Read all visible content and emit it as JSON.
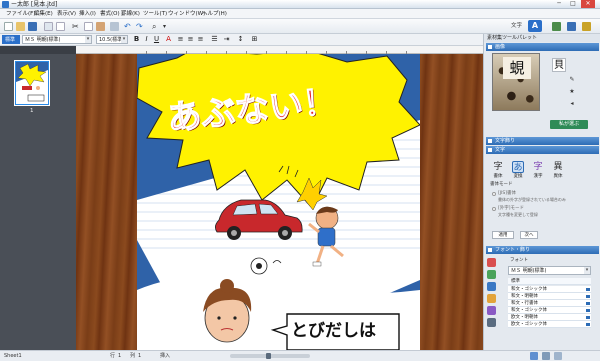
{
  "app": {
    "title": "ー太郎 [見本.jtd]"
  },
  "menus": [
    "ファイル(F)",
    "編集(E)",
    "表示(V)",
    "挿入(I)",
    "書式(O)",
    "罫線(K)",
    "ツール(T)",
    "ウィンドウ(W)",
    "ヘルプ(H)"
  ],
  "toolbar": {
    "mode_label": "文字",
    "mode_button": "A"
  },
  "format": {
    "font_name": "ＭＳ 明朝(標準)",
    "font_size": "10.5(標準)",
    "style_combo": "標準"
  },
  "left_panel": {
    "page_number": "1"
  },
  "right_panel": {
    "title": "素材集ツールパレット",
    "section_image": "画像",
    "kanji": "蜆",
    "tile_kanji": "貝",
    "green_button": "私が選ぶ",
    "section_style": "文字飾り",
    "section_moji": "文字",
    "categories": [
      {
        "glyph": "字",
        "label": "書体"
      },
      {
        "glyph": "あ",
        "label": "変換"
      },
      {
        "glyph": "字",
        "label": "漢字"
      },
      {
        "glyph": "異",
        "label": "異体"
      }
    ],
    "options_header": "書体モード",
    "option1": "[JIS]書体",
    "option1_desc": "書体の外字が登録されている場合のみ",
    "option2": "[外字]モード",
    "option2_desc": "文字種を変更して登録",
    "button_apply": "適用",
    "button_next": "次へ",
    "section_font": "フォント・飾り",
    "font_label": "フォント",
    "font_combo": "ＭＳ 明朝(標準)",
    "font_list_header": "標準",
    "font_items": [
      "和文・ゴシック体",
      "和文・明朝体",
      "和文・行書体",
      "和文・ゴシック体",
      "欧文・明朝体",
      "欧文・ゴシック体"
    ]
  },
  "page_content": {
    "headline": "あぶない！",
    "speech": "とびだしは"
  },
  "status": {
    "sheet": "Sheet1",
    "items": [
      "行",
      "1",
      "列",
      "1",
      "挿入"
    ]
  },
  "colors": {
    "accent": "#2a6fc9",
    "section_blue": "#2d6cb5",
    "burst_yellow": "#fff200",
    "headline_red": "#e5242a",
    "stripe_blue": "#2f62a8"
  }
}
